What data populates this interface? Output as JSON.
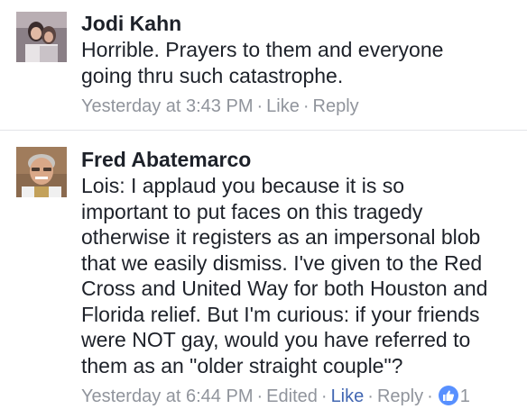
{
  "comments": [
    {
      "author": "Jodi Kahn",
      "text": "Horrible. Prayers to them and everyone\ngoing thru such catastrophe.",
      "timestamp": "Yesterday at 3:43 PM",
      "actions": {
        "like": "Like",
        "reply": "Reply"
      }
    },
    {
      "author": "Fred Abatemarco",
      "text": "Lois: I applaud you because it is so\nimportant to put faces on this tragedy\notherwise it registers as an impersonal blob\nthat we easily dismiss. I've given to the Red\nCross and United Way for both Houston and\nFlorida relief. But I'm curious:  if your friends\nwere NOT gay, would you have referred to\nthem as an \"older straight couple\"?",
      "timestamp": "Yesterday at 6:44 PM",
      "edited": "Edited",
      "actions": {
        "like": "Like",
        "reply": "Reply"
      },
      "reaction_count": "1",
      "reaction_icon": "thumbs-up-icon"
    }
  ],
  "colors": {
    "text": "#1d2129",
    "meta": "#90949c",
    "link_active": "#4267b2",
    "reaction_badge": "#5890ff"
  }
}
